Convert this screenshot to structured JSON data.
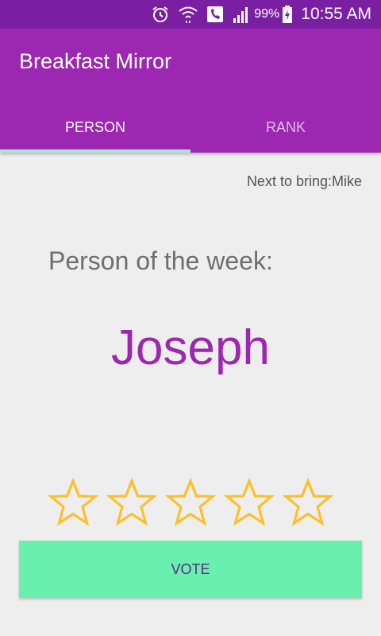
{
  "status_bar": {
    "icons": [
      "alarm-icon",
      "wifi-icon",
      "phone-icon",
      "signal-icon",
      "battery-icon"
    ],
    "battery": "99%",
    "time": "10:55 AM"
  },
  "app_bar": {
    "title": "Breakfast Mirror",
    "tabs": [
      {
        "label": "PERSON",
        "active": true
      },
      {
        "label": "RANK",
        "active": false
      }
    ]
  },
  "main": {
    "next_to_bring": "Next to bring:Mike",
    "heading": "Person of the week:",
    "person_name": "Joseph",
    "rating": {
      "max": 5,
      "value": 0
    },
    "vote_label": "VOTE"
  },
  "colors": {
    "status_bar": "#7b1fa2",
    "primary": "#9c27b0",
    "accent": "#69f0ae",
    "star": "#fbc02d"
  }
}
